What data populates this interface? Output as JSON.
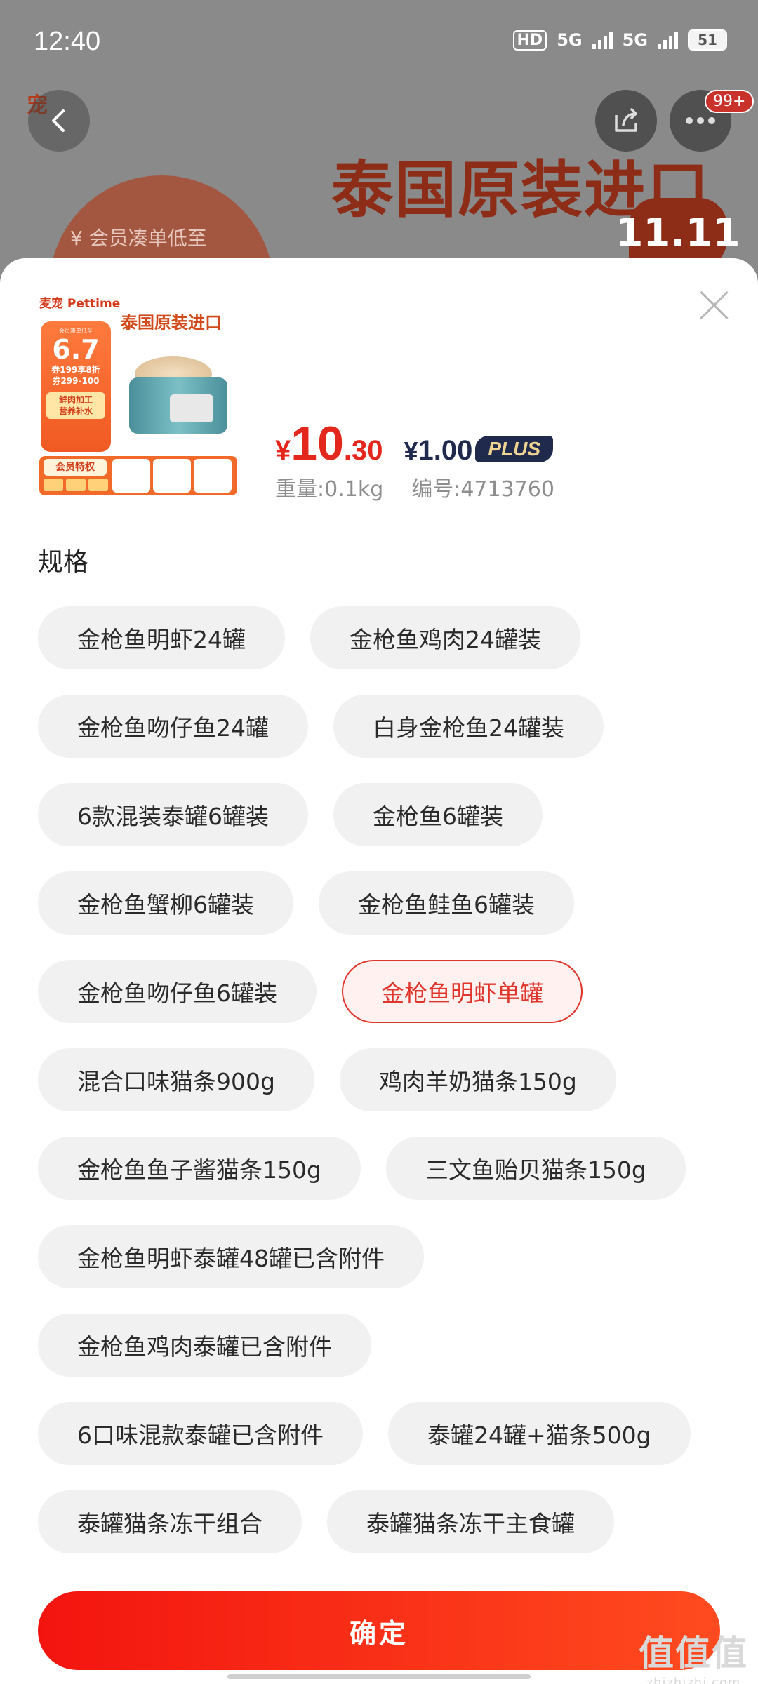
{
  "status_bar": {
    "time": "12:40",
    "hd": "HD",
    "net1": "5G",
    "net2": "5G",
    "battery": "51"
  },
  "background": {
    "logo_text": "宠",
    "headline": "泰国原装进口",
    "event_badge": "11.11",
    "circle_text": "¥ 会员凑单低至",
    "notification_count": "99+"
  },
  "product": {
    "thumb": {
      "logo": "麦宠 Pettime",
      "title": "泰国原装进口",
      "card_small": "会员凑单低至",
      "card_big": "6.7",
      "card_line1": "券199享8折",
      "card_line2": "券299-100",
      "card_tag1": "鲜肉加工",
      "card_tag2": "营养补水",
      "band_header": "会员特权"
    },
    "price_currency": "¥",
    "price_integer": "10",
    "price_decimal": ".30",
    "plus_currency": "¥",
    "plus_price": "1.00",
    "plus_label": "PLUS",
    "weight": "重量:0.1kg",
    "sku": "编号:4713760"
  },
  "spec_title": "规格",
  "specs": [
    "金枪鱼明虾24罐",
    "金枪鱼鸡肉24罐装",
    "金枪鱼吻仔鱼24罐",
    "白身金枪鱼24罐装",
    "6款混装泰罐6罐装",
    "金枪鱼6罐装",
    "金枪鱼蟹柳6罐装",
    "金枪鱼鲑鱼6罐装",
    "金枪鱼吻仔鱼6罐装",
    "金枪鱼明虾单罐",
    "混合口味猫条900g",
    "鸡肉羊奶猫条150g",
    "金枪鱼鱼子酱猫条150g",
    "三文鱼贻贝猫条150g",
    "金枪鱼明虾泰罐48罐已含附件",
    "金枪鱼鸡肉泰罐已含附件",
    "6口味混款泰罐已含附件",
    "泰罐24罐+猫条500g",
    "泰罐猫条冻干组合",
    "泰罐猫条冻干主食罐"
  ],
  "selected_spec": "金枪鱼明虾单罐",
  "confirm_label": "确定",
  "watermark": {
    "big": "值值值",
    "small": "zhizhizhi.com"
  },
  "colors": {
    "accent": "#e4271c",
    "plus_navy": "#1f2a4d",
    "chip_bg": "#f1f1f1"
  }
}
